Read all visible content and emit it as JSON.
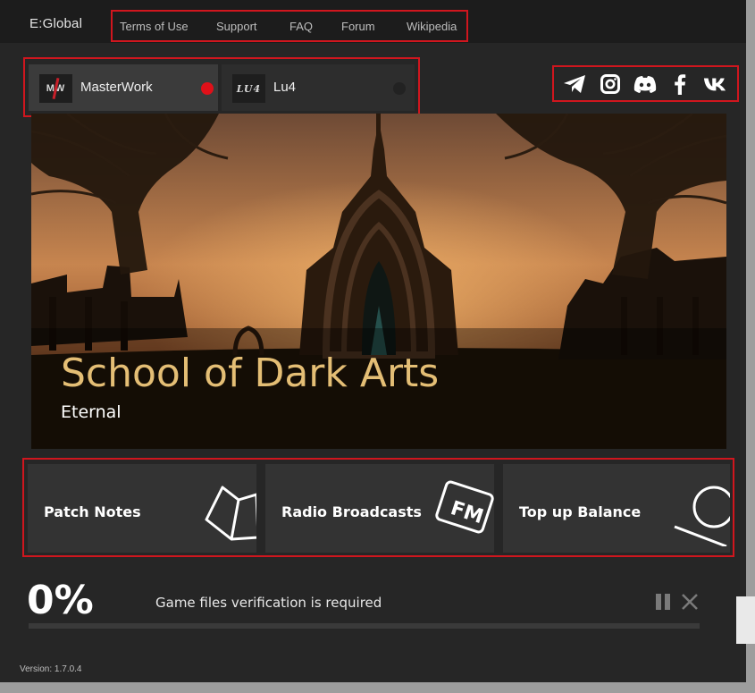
{
  "app": {
    "logo": "E:Global",
    "version": "Version: 1.7.0.4"
  },
  "nav": {
    "items": [
      "Terms of Use",
      "Support",
      "FAQ",
      "Forum",
      "Wikipedia"
    ]
  },
  "servers": [
    {
      "logo": "MW",
      "label": "MasterWork",
      "status_color": "#e01019"
    },
    {
      "logo": "LU4",
      "label": "Lu4",
      "status_color": "#222222"
    }
  ],
  "social": [
    "telegram-icon",
    "instagram-icon",
    "discord-icon",
    "facebook-icon",
    "vk-icon"
  ],
  "banner": {
    "title": "School of Dark Arts",
    "subtitle": "Eternal"
  },
  "cards": [
    {
      "label": "Patch Notes",
      "icon": "book-icon"
    },
    {
      "label": "Radio Broadcasts",
      "icon": "fm-radio-icon"
    },
    {
      "label": "Top up Balance",
      "icon": "coin-icon"
    }
  ],
  "download": {
    "percent": "0%",
    "progress": 0,
    "status": "Game files verification is required"
  },
  "colors": {
    "accent": "#d0161e",
    "gold": "#e4be75",
    "background": "#262626"
  }
}
